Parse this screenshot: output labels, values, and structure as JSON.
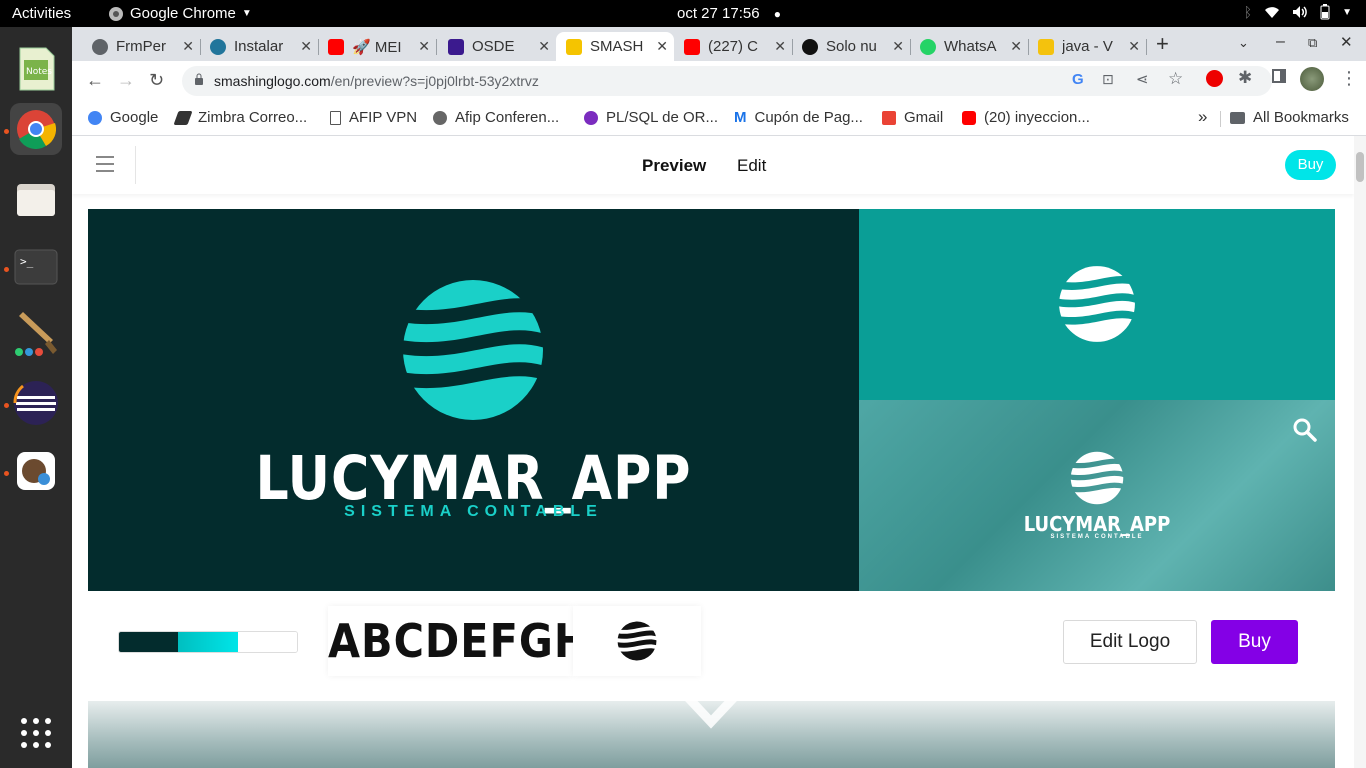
{
  "topbar": {
    "activities": "Activities",
    "app": "Google Chrome",
    "clock": "oct 27  17:56"
  },
  "tabs": [
    {
      "title": "FrmPer",
      "color": "#5f6368"
    },
    {
      "title": "Instalar",
      "color": "#21759b"
    },
    {
      "title": "🚀 MEI",
      "color": "#ff0000"
    },
    {
      "title": "OSDE",
      "color": "#3b1a8e"
    },
    {
      "title": "SMASH",
      "color": "#f5c400"
    },
    {
      "title": "(227) C",
      "color": "#ff0000"
    },
    {
      "title": "Solo nu",
      "color": "#111111"
    },
    {
      "title": "WhatsA",
      "color": "#25d366"
    },
    {
      "title": "java - V",
      "color": "#f4c20d"
    }
  ],
  "omnibox": {
    "host": "smashinglogo.com",
    "path": "/en/preview?s=j0pj0lrbt-53y2xtrvz"
  },
  "bookmarks": [
    {
      "label": "Google",
      "color": "#4285f4"
    },
    {
      "label": "Zimbra Correo...",
      "color": "#333333"
    },
    {
      "label": "AFIP VPN",
      "color": "#555555"
    },
    {
      "label": "Afip Conferen...",
      "color": "#666666"
    },
    {
      "label": "PL/SQL de OR...",
      "color": "#7b2cbf"
    },
    {
      "label": "Cupón de Pag...",
      "color": "#1a73e8"
    },
    {
      "label": "Gmail",
      "color": "#ea4335"
    },
    {
      "label": "(20) inyeccion...",
      "color": "#ff0000"
    }
  ],
  "bookmarks_more": "»",
  "all_bookmarks": "All Bookmarks",
  "site": {
    "nav_preview": "Preview",
    "nav_edit": "Edit",
    "header_buy": "Buy",
    "logo_name": "LUCYMAR_APP",
    "logo_sub": "SISTEMA CONTABLE",
    "font_sample": "ABCDEFGH",
    "edit_logo": "Edit Logo",
    "buy": "Buy",
    "palette": [
      "#032c2d",
      "#00e5e8",
      "#ffffff"
    ]
  }
}
